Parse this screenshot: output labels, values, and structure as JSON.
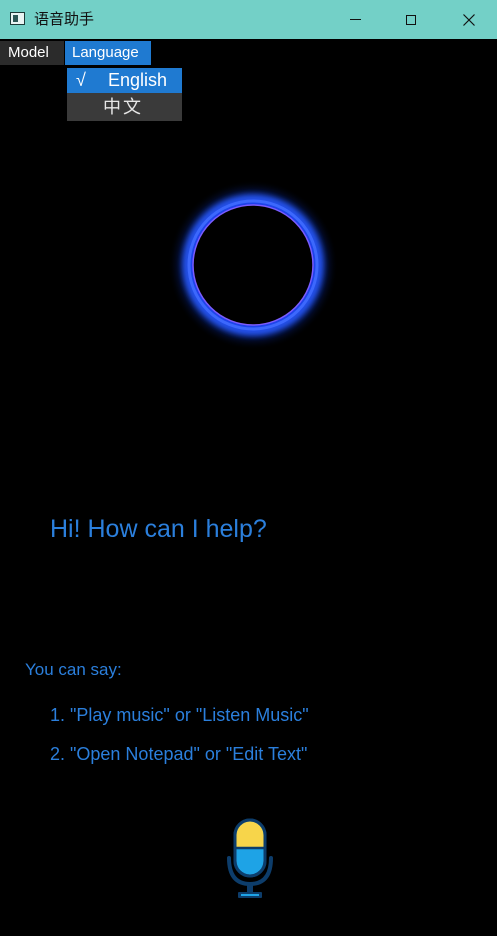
{
  "window": {
    "title": "语音助手",
    "icon": "app-window-icon",
    "controls": [
      "minimize-icon",
      "maximize-icon",
      "close-icon"
    ]
  },
  "menubar": {
    "items": [
      {
        "label": "Model"
      },
      {
        "label": "Language",
        "active": true
      }
    ]
  },
  "language_menu": {
    "items": [
      {
        "label": "English",
        "check": "√",
        "selected": true
      },
      {
        "label": "中文",
        "check": "",
        "selected": false
      }
    ]
  },
  "main": {
    "orb_icon": "glowing-ring-icon",
    "greeting": "Hi! How can I help?",
    "hint_heading": "You can say:",
    "hints": [
      "1. \"Play music\" or \"Listen Music\"",
      "2. \"Open Notepad\" or \"Edit Text\""
    ],
    "mic_icon": "microphone-icon"
  },
  "colors": {
    "titlebar": "#73d0c7",
    "accent": "#1f7ad1",
    "text_blue": "#2b7fdc",
    "background": "#000000",
    "orb_glow": "#1a4fff",
    "orb_ring": "#7a5cff",
    "mic_yellow": "#f7d54a",
    "mic_blue": "#1ea3e6",
    "mic_outline": "#0d3d6b"
  }
}
